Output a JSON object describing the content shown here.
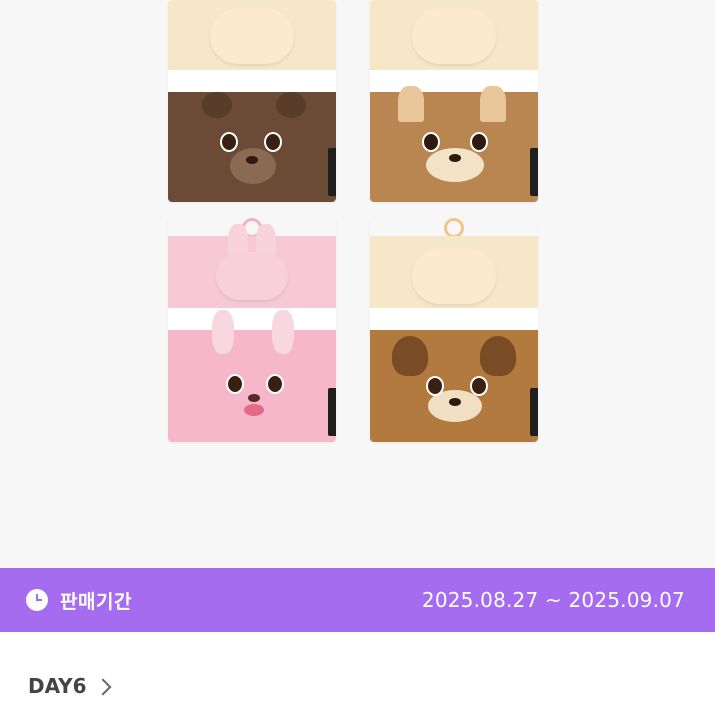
{
  "product": {
    "image_alt": "Plush tissue pouch set"
  },
  "sales_period": {
    "icon": "clock-icon",
    "label": "판매기간",
    "dates": "2025.08.27 ~ 2025.09.07",
    "bar_color": "#a66cf0"
  },
  "artist": {
    "name": "DAY6",
    "icon": "chevron-right-icon"
  }
}
